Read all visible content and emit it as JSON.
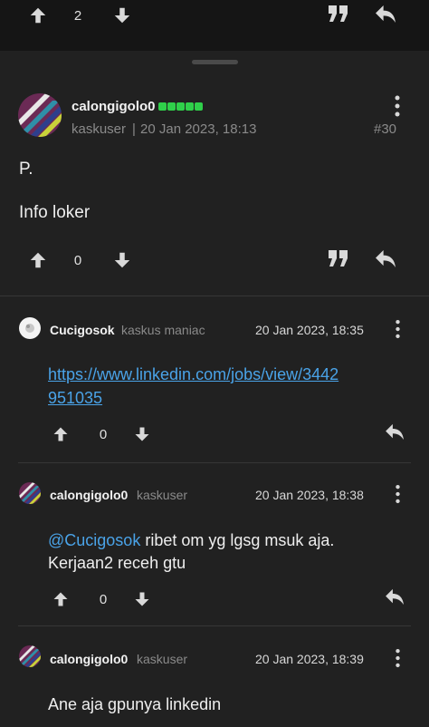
{
  "top_actions": {
    "vote_count": "2"
  },
  "post": {
    "username": "calongigolo0",
    "rank": "kaskuser",
    "separator": "|",
    "timestamp": "20 Jan 2023, 18:13",
    "post_number": "#30",
    "body_line1": "P.",
    "body_line2": "Info loker",
    "vote_count": "0"
  },
  "replies": [
    {
      "username": "Cucigosok",
      "rank": "kaskus maniac",
      "timestamp": "20 Jan 2023, 18:35",
      "link_line1": "https://www.linkedin.com/jobs/view/3442",
      "link_line2": "951035",
      "vote_count": "0"
    },
    {
      "username": "calongigolo0",
      "rank": "kaskuser",
      "timestamp": "20 Jan 2023, 18:38",
      "mention": "@Cucigosok",
      "text_line1": " ribet om yg lgsg msuk aja.",
      "text_line2": "Kerjaan2 receh gtu",
      "vote_count": "0"
    },
    {
      "username": "calongigolo0",
      "rank": "kaskuser",
      "timestamp": "20 Jan 2023, 18:39",
      "text_line1": "Ane aja gpunya linkedin"
    }
  ],
  "colors": {
    "accent_link": "#4aa3e8",
    "level_green": "#2fd04a",
    "background": "#212121"
  },
  "icons": [
    "upvote-icon",
    "downvote-icon",
    "quote-icon",
    "reply-icon",
    "more-options-icon"
  ]
}
